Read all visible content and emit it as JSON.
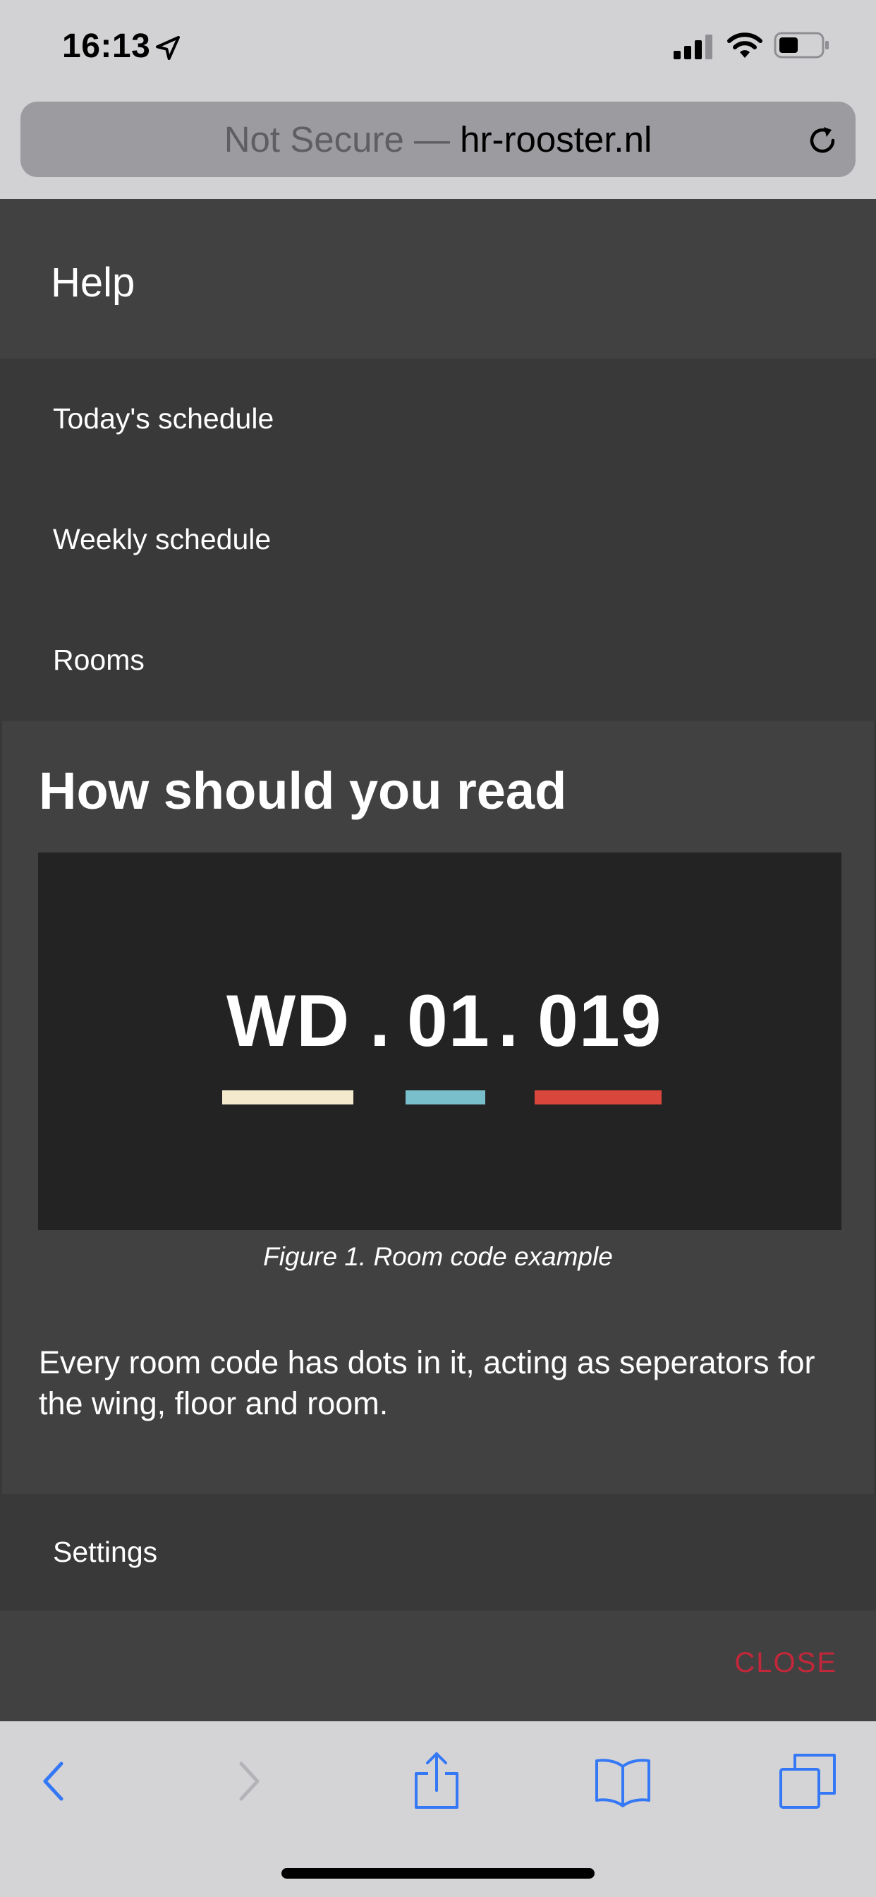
{
  "status_bar": {
    "time": "16:13",
    "icons": [
      "location-arrow-icon",
      "cellular-signal-icon",
      "wifi-icon",
      "battery-icon"
    ]
  },
  "browser": {
    "url_prefix": "Not Secure — ",
    "url_domain": "hr-rooster.nl",
    "reload_icon": "reload-icon"
  },
  "page": {
    "title": "Help",
    "menu_items": [
      {
        "label": "Today's schedule"
      },
      {
        "label": "Weekly schedule"
      },
      {
        "label": "Rooms"
      }
    ],
    "panel": {
      "heading": "How should you read",
      "figure": {
        "wing": "WD",
        "separator": ".",
        "floor": "01",
        "room": "019",
        "colors": {
          "wing": "#f4e9cd",
          "floor": "#79bfcb",
          "room": "#d9463b"
        }
      },
      "caption": "Figure 1. Room code example",
      "text": "Every room code has dots in it, acting as seperators for the wing, floor and room."
    },
    "settings_label": "Settings",
    "close_label": "CLOSE"
  },
  "toolbar": {
    "buttons": [
      "back-icon",
      "forward-icon",
      "share-icon",
      "bookmarks-icon",
      "tabs-icon"
    ],
    "accent": "#3478f6"
  }
}
